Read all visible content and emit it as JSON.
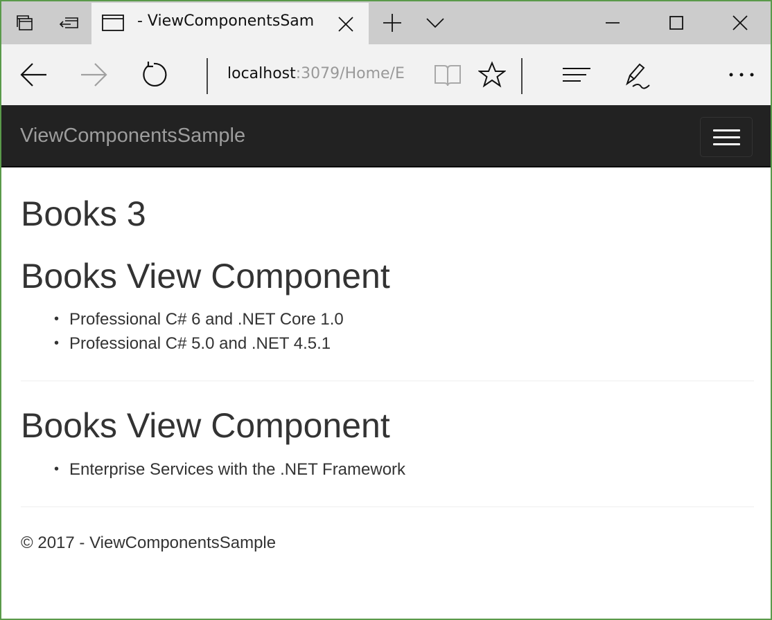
{
  "tab": {
    "title": "- ViewComponentsSam"
  },
  "address": {
    "host": "localhost",
    "path": ":3079/Home/E"
  },
  "icons": {
    "tab_preview": "tab-preview-icon",
    "set_aside": "set-aside-tabs-icon",
    "page": "page-icon",
    "close_tab": "close-icon",
    "new_tab": "plus-icon",
    "tab_list": "chevron-down-icon",
    "minimize": "minimize-icon",
    "maximize": "maximize-icon",
    "close_window": "close-icon",
    "back": "back-arrow-icon",
    "forward": "forward-arrow-icon",
    "refresh": "refresh-icon",
    "reading_view": "book-icon",
    "favorite": "star-icon",
    "hub": "hub-icon",
    "notes": "pen-icon",
    "more": "more-icon"
  },
  "navbar": {
    "brand": "ViewComponentsSample"
  },
  "page": {
    "title": "Books 3",
    "sections": [
      {
        "heading": "Books View Component",
        "books": [
          "Professional C# 6 and .NET Core 1.0",
          "Professional C# 5.0 and .NET 4.5.1"
        ]
      },
      {
        "heading": "Books View Component",
        "books": [
          "Enterprise Services with the .NET Framework"
        ]
      }
    ],
    "footer": "© 2017 - ViewComponentsSample"
  },
  "colors": {
    "navbar_bg": "#222222",
    "brand": "#9d9d9d",
    "text": "#333333",
    "window_border": "#5a9a4a"
  }
}
